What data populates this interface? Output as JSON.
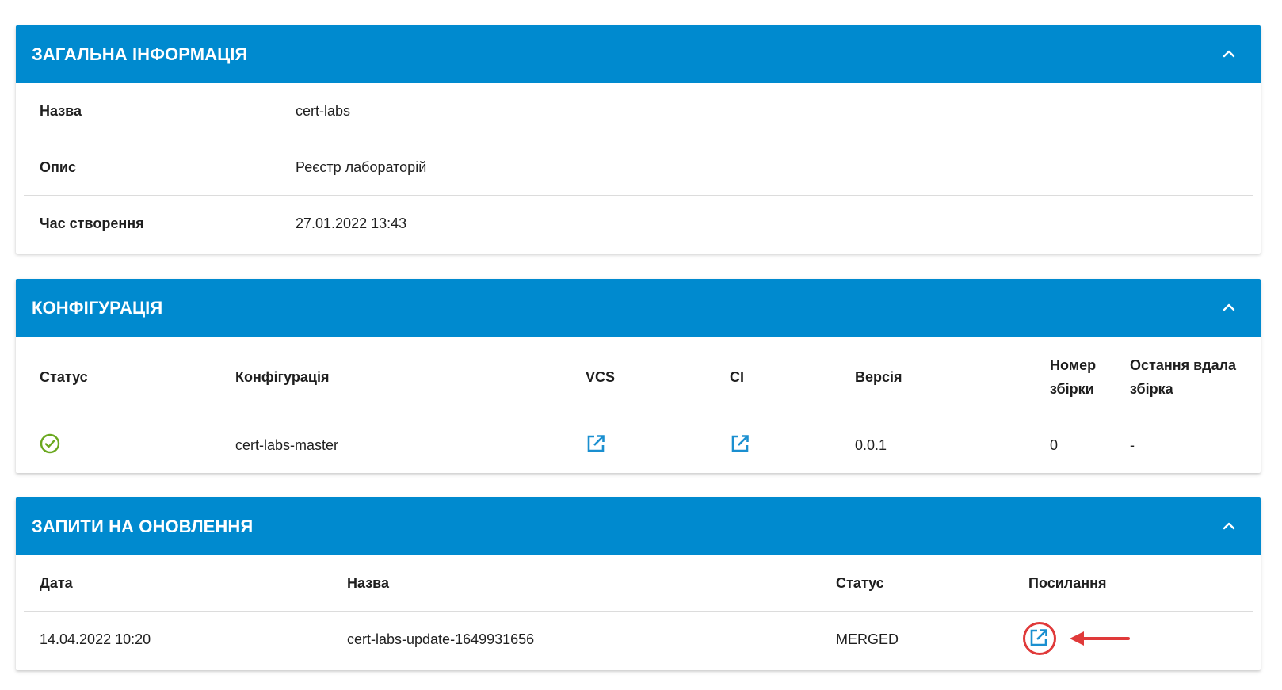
{
  "general": {
    "title": "ЗАГАЛЬНА ІНФОРМАЦІЯ",
    "rows": [
      {
        "label": "Назва",
        "value": "cert-labs"
      },
      {
        "label": "Опис",
        "value": "Реєстр лабораторій"
      },
      {
        "label": "Час створення",
        "value": "27.01.2022 13:43"
      }
    ]
  },
  "configuration": {
    "title": "КОНФІГУРАЦІЯ",
    "headers": [
      "Статус",
      "Конфігурація",
      "VCS",
      "CI",
      "Версія",
      "Номер збірки",
      "Остання вдала збірка"
    ],
    "row": {
      "status_icon": "check-circle-icon",
      "status_color": "#6aa81f",
      "name": "cert-labs-master",
      "vcs_icon": "external-link-icon",
      "ci_icon": "external-link-icon",
      "version": "0.0.1",
      "build_number": "0",
      "last_success": "-"
    }
  },
  "merge_requests": {
    "title": "ЗАПИТИ НА ОНОВЛЕННЯ",
    "headers": [
      "Дата",
      "Назва",
      "Статус",
      "Посилання"
    ],
    "rows": [
      {
        "date": "14.04.2022 10:20",
        "name": "cert-labs-update-1649931656",
        "status": "MERGED",
        "link_icon": "external-link-icon"
      }
    ]
  },
  "colors": {
    "header_bg": "#008acf",
    "link_icon": "#1a8fd0",
    "annotation": "#e03a3a"
  }
}
